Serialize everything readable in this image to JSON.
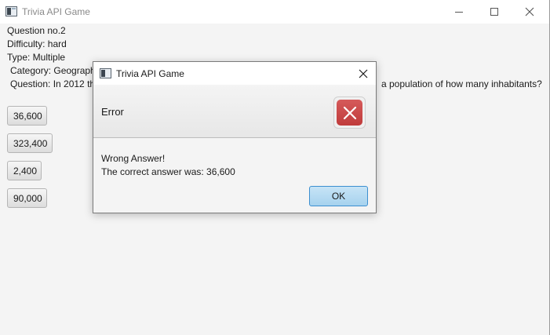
{
  "window": {
    "title": "Trivia API Game"
  },
  "game": {
    "question_no": "Question no.2",
    "difficulty": "Difficulty: hard",
    "type": "Type: Multiple",
    "category": "Category: Geograph",
    "question_start": "Question: In 2012 th",
    "question_end": "a population of how many inhabitants?",
    "answers": [
      "36,600",
      "323,400",
      "2,400",
      "90,000"
    ]
  },
  "dialog": {
    "title": "Trivia API Game",
    "header": "Error",
    "message_line1": "Wrong Answer!",
    "message_line2": "The correct answer was: 36,600",
    "ok_label": "OK",
    "icon": "error-icon",
    "accent_color": "#c94848"
  }
}
